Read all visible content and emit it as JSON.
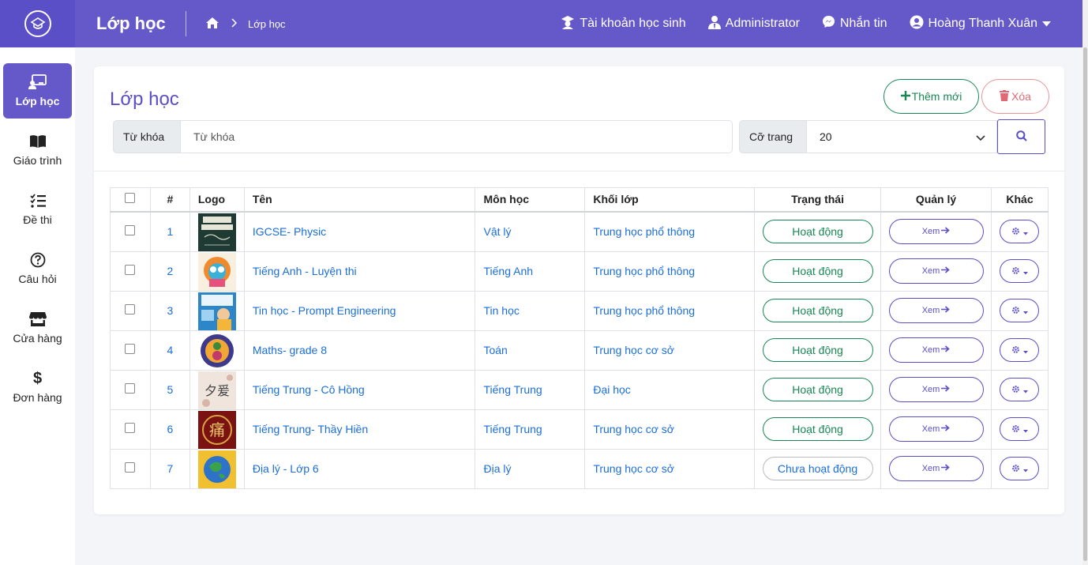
{
  "header": {
    "page_title": "Lớp học",
    "breadcrumb": "Lớp học",
    "links": [
      {
        "label": "Tài khoản học sinh",
        "icon": "student-icon"
      },
      {
        "label": "Administrator",
        "icon": "user-tie-icon"
      },
      {
        "label": "Nhắn tin",
        "icon": "messenger-icon"
      },
      {
        "label": "Hoàng Thanh Xuân",
        "icon": "user-circle-icon"
      }
    ]
  },
  "sidebar": {
    "items": [
      {
        "label": "Lớp học",
        "icon": "classroom-icon",
        "active": true
      },
      {
        "label": "Giáo trình",
        "icon": "book-icon"
      },
      {
        "label": "Đề thi",
        "icon": "checklist-icon"
      },
      {
        "label": "Câu hỏi",
        "icon": "question-icon"
      },
      {
        "label": "Cửa hàng",
        "icon": "store-icon"
      },
      {
        "label": "Đơn hàng",
        "icon": "dollar-icon"
      }
    ]
  },
  "main": {
    "title": "Lớp học",
    "add_label": "Thêm mới",
    "delete_label": "Xóa",
    "search": {
      "keyword_label": "Từ khóa",
      "keyword_placeholder": "Từ khóa",
      "page_size_label": "Cỡ trang",
      "page_size_value": "20"
    },
    "table": {
      "headers": [
        "#",
        "Logo",
        "Tên",
        "Môn học",
        "Khối lớp",
        "Trạng thái",
        "Quản lý",
        "Khác"
      ],
      "view_label": "Xem",
      "rows": [
        {
          "num": "1",
          "name": "IGCSE- Physic",
          "subject": "Vật lý",
          "grade": "Trung học phổ thông",
          "status": "Hoạt động",
          "active": true
        },
        {
          "num": "2",
          "name": "Tiếng Anh - Luyện thi",
          "subject": "Tiếng Anh",
          "grade": "Trung học phổ thông",
          "status": "Hoạt động",
          "active": true
        },
        {
          "num": "3",
          "name": "Tin học - Prompt Engineering",
          "subject": "Tin học",
          "grade": "Trung học phổ thông",
          "status": "Hoạt động",
          "active": true
        },
        {
          "num": "4",
          "name": "Maths- grade 8",
          "subject": "Toán",
          "grade": "Trung học cơ sở",
          "status": "Hoạt động",
          "active": true
        },
        {
          "num": "5",
          "name": "Tiếng Trung - Cô Hồng",
          "subject": "Tiếng Trung",
          "grade": "Đại học",
          "status": "Hoạt động",
          "active": true
        },
        {
          "num": "6",
          "name": "Tiếng Trung- Thầy Hiền",
          "subject": "Tiếng Trung",
          "grade": "Trung học cơ sở",
          "status": "Hoạt động",
          "active": true
        },
        {
          "num": "7",
          "name": "Địa lý - Lớp 6",
          "subject": "Địa lý",
          "grade": "Trung học cơ sở",
          "status": "Chưa hoạt động",
          "active": false
        }
      ]
    }
  },
  "colors": {
    "primary": "#6558c8",
    "success": "#198754",
    "danger": "#e06a74",
    "link": "#1a6ed8"
  }
}
